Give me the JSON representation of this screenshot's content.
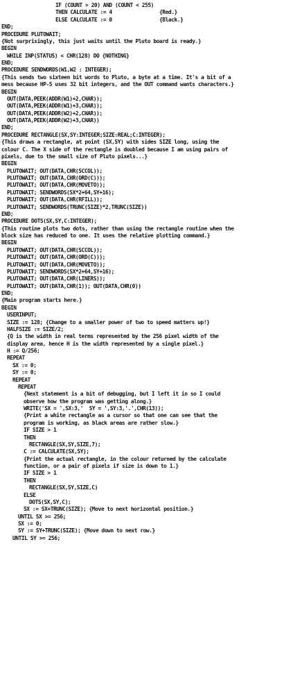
{
  "lines": [
    {
      "indent": 80,
      "text": "IF (COUNT > 20) AND (COUNT < 255)"
    },
    {
      "indent": 80,
      "text": "THEN CALCULATE := 4",
      "comment": "{Red.}"
    },
    {
      "indent": 80,
      "text": "ELSE CALCULATE := 0",
      "comment": "{Black.}"
    },
    {
      "indent": 2,
      "text": "END;"
    },
    {
      "indent": 2,
      "text": "PROCEDURE PLUTOWAIT;"
    },
    {
      "indent": 2,
      "text": "{Not surprisingly, this just waits until the Pluto board is ready.}"
    },
    {
      "indent": 2,
      "text": "BEGIN"
    },
    {
      "indent": 10,
      "text": "WHILE INP(STATUS) < CHR(128) DO {NOTHING}"
    },
    {
      "indent": 2,
      "text": "END;"
    },
    {
      "indent": 2,
      "text": "PROCEDURE SENDWORDS(W1,W2 : INTEGER);"
    },
    {
      "indent": 2,
      "text": "{This sends two sixteen bit words to Pluto, a byte at a time. It's a bit of a"
    },
    {
      "indent": 2,
      "text": "mess because HP-5 uses 32 bit integers, and the OUT command wants characters.}"
    },
    {
      "indent": 2,
      "text": "BEGIN"
    },
    {
      "indent": 10,
      "text": "OUT(DATA,PEEK(ADDR(W1)+2,CHAR));"
    },
    {
      "indent": 10,
      "text": "OUT(DATA,PEEK(ADDR(W1)+3,CHAR));"
    },
    {
      "indent": 10,
      "text": "OUT(DATA,PEEK(ADDR(W2)+2,CHAR));"
    },
    {
      "indent": 10,
      "text": "OUT(DATA,PEEK(ADDR(W2)+3,CHAR))"
    },
    {
      "indent": 2,
      "text": "END;"
    },
    {
      "indent": 2,
      "text": "PROCEDURE RECTANGLE(SX,SY:INTEGER;SIZE:REAL;C:INTEGER);"
    },
    {
      "indent": 2,
      "text": "{This draws a rectangle, at point (SX,SY) with sides SIZE long, using the"
    },
    {
      "indent": 2,
      "text": "colour C. The X side of the rectangle is doubled because I am using pairs of"
    },
    {
      "indent": 2,
      "text": "pixels, due to the small size of Pluto pixels...}"
    },
    {
      "indent": 2,
      "text": "BEGIN"
    },
    {
      "indent": 10,
      "text": "PLUTOWAIT; OUT(DATA,CHR(SCCOL));"
    },
    {
      "indent": 10,
      "text": "PLUTOWAIT; OUT(DATA,CHR(ORD(C)));"
    },
    {
      "indent": 10,
      "text": "PLUTOWAIT; OUT(DATA,CHR(MOVETO));"
    },
    {
      "indent": 10,
      "text": "PLUTOWAIT; SENDWORDS(SX*2+64,SY+16);"
    },
    {
      "indent": 10,
      "text": "PLUTOWAIT; OUT(DATA,CHR(RFILL));"
    },
    {
      "indent": 10,
      "text": "PLUTOWAIT; SENDWORDS(TRUNC(SIZE)*2,TRUNC(SIZE))"
    },
    {
      "indent": 2,
      "text": "END;"
    },
    {
      "indent": 2,
      "text": "PROCEDURE DOTS(SX,SY,C:INTEGER);"
    },
    {
      "indent": 2,
      "text": "{This routine plots two dots, rather than using the rectangle routine when the"
    },
    {
      "indent": 2,
      "text": "block size has reduced to one. It uses the relative plotting command.}"
    },
    {
      "indent": 2,
      "text": "BEGIN"
    },
    {
      "indent": 10,
      "text": "PLUTOWAIT; OUT(DATA,CHR(SCCOL));"
    },
    {
      "indent": 10,
      "text": "PLUTOWAIT; OUT(DATA,CHR(ORD(C)));"
    },
    {
      "indent": 10,
      "text": "PLUTOWAIT; OUT(DATA,CHR(MOVETO));"
    },
    {
      "indent": 10,
      "text": "PLUTOWAIT; SENDWORDS(SX*2+64,SY+16);"
    },
    {
      "indent": 10,
      "text": "PLUTOWAIT; OUT(DATA,CHR(LINERS));"
    },
    {
      "indent": 10,
      "text": "PLUTOWAIT; OUT(DATA,CHR(1)); OUT(DATA,CHR(0))"
    },
    {
      "indent": 2,
      "text": "END;"
    },
    {
      "indent": 2,
      "text": "{Main program starts here.}"
    },
    {
      "indent": 2,
      "text": "BEGIN"
    },
    {
      "indent": 10,
      "text": "USERINPUT;"
    },
    {
      "indent": 10,
      "text": "SIZE := 128; {Change to a smaller power of two to speed matters up!}"
    },
    {
      "indent": 10,
      "text": "HALFSIZE := SIZE/2;"
    },
    {
      "indent": 10,
      "text": "{Q is the width in real terms represented by the 256 pixel width of the"
    },
    {
      "indent": 10,
      "text": "display area, hence H is the width represented by a single pixel.}"
    },
    {
      "indent": 10,
      "text": "H := Q/256;"
    },
    {
      "indent": 10,
      "text": "REPEAT"
    },
    {
      "indent": 18,
      "text": "SX := 0;"
    },
    {
      "indent": 18,
      "text": "SY := 0;"
    },
    {
      "indent": 18,
      "text": "REPEAT"
    },
    {
      "indent": 26,
      "text": "REPEAT"
    },
    {
      "indent": 34,
      "text": "{Next statement is a bit of debugging, but I left it in so I could"
    },
    {
      "indent": 34,
      "text": "observe how the program was getting along.}"
    },
    {
      "indent": 34,
      "text": "WRITE('SX = ',SX:3,'  SY = ',SY:3,'.',CHR(13));"
    },
    {
      "indent": 34,
      "text": "{Print a white rectangle as a cursor so that one can see that the"
    },
    {
      "indent": 34,
      "text": "program is working, as black areas are rather slow.}"
    },
    {
      "indent": 34,
      "text": "IF SIZE > 1"
    },
    {
      "indent": 34,
      "text": "THEN"
    },
    {
      "indent": 42,
      "text": "RECTANGLE(SX,SY,SIZE,7);"
    },
    {
      "indent": 34,
      "text": "C := CALCULATE(SX,SY);"
    },
    {
      "indent": 34,
      "text": "{Print the actual rectangle, in the colour returned by the calculate"
    },
    {
      "indent": 34,
      "text": "function, or a pair of pixels if size is down to 1.}"
    },
    {
      "indent": 34,
      "text": "IF SIZE > 1"
    },
    {
      "indent": 34,
      "text": "THEN"
    },
    {
      "indent": 42,
      "text": "RECTANGLE(SX,SY,SIZE,C)"
    },
    {
      "indent": 34,
      "text": "ELSE"
    },
    {
      "indent": 42,
      "text": "DOTS(SX,SY,C);"
    },
    {
      "indent": 34,
      "text": "SX := SX+TRUNC(SIZE); {Move to next horizontal position.}"
    },
    {
      "indent": 26,
      "text": "UNTIL SX >= 256;"
    },
    {
      "indent": 26,
      "text": "SX := 0;"
    },
    {
      "indent": 26,
      "text": "SY := SY+TRUNC(SIZE); {Move down to next row.}"
    },
    {
      "indent": 18,
      "text": "UNTIL SY >= 256;"
    }
  ]
}
